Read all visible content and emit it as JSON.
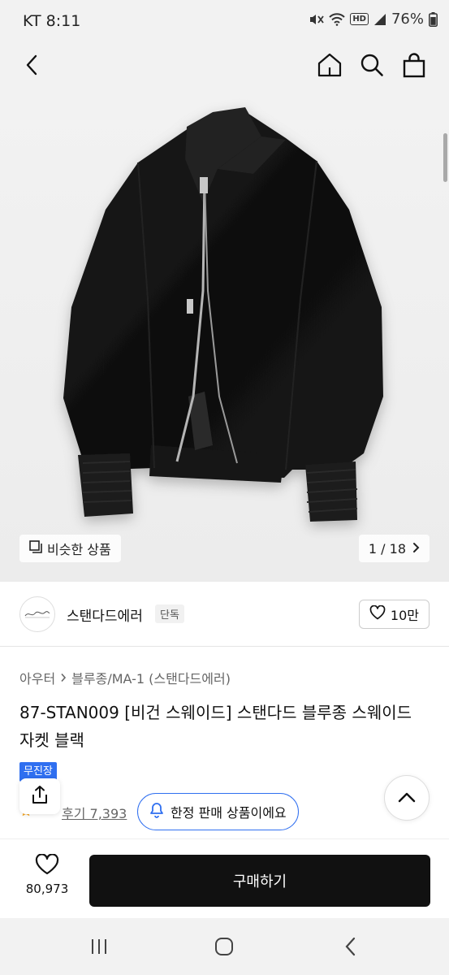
{
  "status_bar": {
    "carrier_time": "KT 8:11",
    "battery": "76%",
    "hd_label": "HD",
    "icons": [
      "mute-vibrate-icon",
      "wifi-icon",
      "hd-voice-icon",
      "signal-icon",
      "battery-icon"
    ]
  },
  "nav": {
    "icons": [
      "back-icon",
      "home-icon",
      "search-icon",
      "cart-icon"
    ]
  },
  "gallery": {
    "similar_label": "비슷한 상품",
    "counter": "1 / 18"
  },
  "brand": {
    "name": "스탠다드에러",
    "tag": "단독",
    "likes": "10만"
  },
  "breadcrumb": {
    "category": "아우터",
    "subcategory": "블루종/MA-1 (스탠다드에러)"
  },
  "product": {
    "title": "87-STAN009 [비건 스웨이드] 스탠다드 블루종 스웨이드 자켓 블랙",
    "badge": "무진장",
    "review_text": "후기 7,393"
  },
  "limited": {
    "label": "한정 판매 상품이에요"
  },
  "bottom": {
    "wish_count": "80,973",
    "buy_label": "구매하기"
  },
  "colors": {
    "accent": "#2f6ff0",
    "buy_button": "#111111",
    "star": "#f5a623"
  }
}
